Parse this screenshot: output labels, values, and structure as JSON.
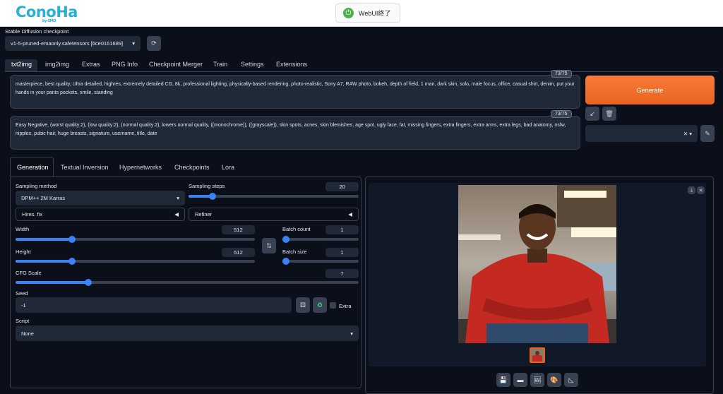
{
  "header": {
    "logo": "ConoHa",
    "logo_sub": "by GMO",
    "webui_button": "WebUI終了"
  },
  "checkpoint": {
    "label": "Stable Diffusion checkpoint",
    "value": "v1-5-pruned-emaonly.safetensors [6ce0161689]"
  },
  "main_tabs": [
    "txt2img",
    "img2img",
    "Extras",
    "PNG Info",
    "Checkpoint Merger",
    "Train",
    "Settings",
    "Extensions"
  ],
  "prompt": {
    "counter": "73/75",
    "text": "masterpiece, best quality, Ultra detailed, highres, extremely detailed CG, 8k, professional lighting, physically-based rendering, photo-realistic, Sony A7, RAW photo, bokeh, depth of field, 1 man, dark skin, solo, male focus, office, casual shirt, denim, put your hands in your pants pockets, smile, standing"
  },
  "negative_prompt": {
    "counter": "73/75",
    "text": "Easy Negative, (worst quality:2), (low quality:2), (normal quality:2), lowers normal quality, ((monochrome)), ((grayscale)), skin spots, acnes, skin blemishes, age spot, ugly face, fat, missing fingers, extra fingers, extra arms, extra legs, bad anatomy, nsfw, nipples, pubic hair, huge breasts, signature, username, title, date"
  },
  "generate_label": "Generate",
  "sub_tabs": [
    "Generation",
    "Textual Inversion",
    "Hypernetworks",
    "Checkpoints",
    "Lora"
  ],
  "sampling_method": {
    "label": "Sampling method",
    "value": "DPM++ 2M Karras"
  },
  "sampling_steps": {
    "label": "Sampling steps",
    "value": "20"
  },
  "hires_fix": "Hires. fix",
  "refiner": "Refiner",
  "width": {
    "label": "Width",
    "value": "512"
  },
  "height": {
    "label": "Height",
    "value": "512"
  },
  "batch_count": {
    "label": "Batch count",
    "value": "1"
  },
  "batch_size": {
    "label": "Batch size",
    "value": "1"
  },
  "cfg_scale": {
    "label": "CFG Scale",
    "value": "7"
  },
  "seed": {
    "label": "Seed",
    "value": "-1",
    "extra_label": "Extra"
  },
  "script": {
    "label": "Script",
    "value": "None"
  },
  "colors": {
    "accent": "#3b82f6",
    "generate": "#f47230",
    "background": "#0b0f19"
  }
}
